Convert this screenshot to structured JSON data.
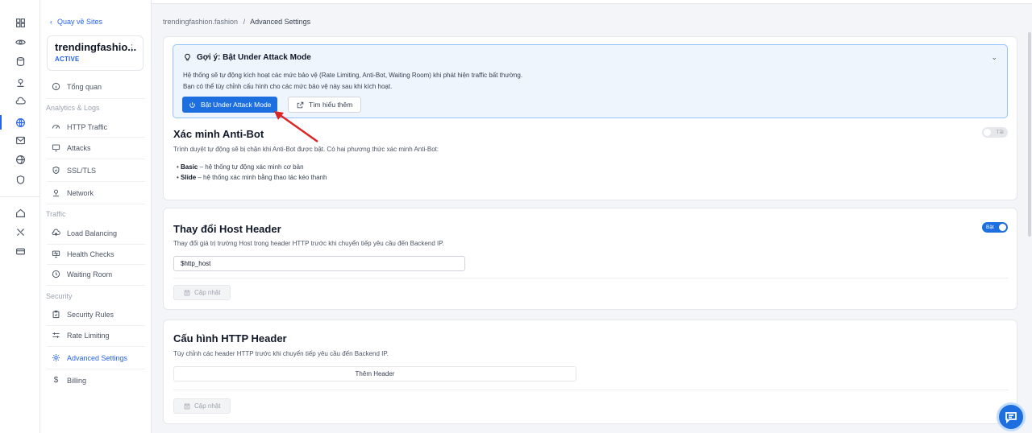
{
  "sidebar": {
    "back_label": "Quay về Sites",
    "site_name": "trendingfashio...",
    "site_status": "ACTIVE",
    "overview": "Tổng quan",
    "analytics_label": "Analytics & Logs",
    "analytics_items": [
      "HTTP Traffic",
      "Attacks",
      "SSL/TLS",
      "Network"
    ],
    "traffic_label": "Traffic",
    "traffic_items": [
      "Load Balancing",
      "Health Checks",
      "Waiting Room"
    ],
    "security_label": "Security",
    "security_items": [
      "Security Rules",
      "Rate Limiting",
      "Advanced Settings"
    ],
    "billing": "Billing",
    "active_item": "Advanced Settings"
  },
  "breadcrumb": {
    "site": "trendingfashion.fashion",
    "separator": "/",
    "current": "Advanced Settings"
  },
  "hint": {
    "title": "Gợi ý: Bật Under Attack Mode",
    "line1": "Hệ thống sẽ tự động kích hoạt các mức bảo vệ (Rate Limiting, Anti-Bot, Waiting Room) khi phát hiện traffic bất thường.",
    "line2": "Bạn có thể tùy chỉnh cấu hình cho các mức bảo vệ này sau khi kích hoạt.",
    "primary_button": "Bật Under Attack Mode",
    "secondary_button": "Tìm hiểu thêm"
  },
  "antibot": {
    "title": "Xác minh Anti-Bot",
    "description": "Trình duyệt tự động sẽ bị chặn khi Anti-Bot được bật. Có hai phương thức xác minh Anti-Bot:",
    "bullets": [
      {
        "name": "Basic",
        "text": " – hệ thống tự động xác minh cơ bản"
      },
      {
        "name": "Slide",
        "text": " – hệ thống xác minh bằng thao tác kéo thanh"
      }
    ],
    "toggle_label": "Tắt",
    "enabled": false
  },
  "host_header": {
    "title": "Thay đổi Host Header",
    "description": "Thay đổi giá trị trường Host trong header HTTP trước khi chuyển tiếp yêu cầu đến Backend IP.",
    "value": "$http_host",
    "toggle_label": "Bật",
    "enabled": true,
    "update_button": "Cập nhật"
  },
  "http_header": {
    "title": "Cấu hình HTTP Header",
    "description": "Tùy chỉnh các header HTTP trước khi chuyển tiếp yêu cầu đến Backend IP.",
    "add_button": "Thêm Header",
    "update_button": "Cập nhật"
  },
  "colors": {
    "accent": "#1d6fe0",
    "hint_bg": "#eef5fc",
    "annotation_arrow": "#dc2626"
  }
}
